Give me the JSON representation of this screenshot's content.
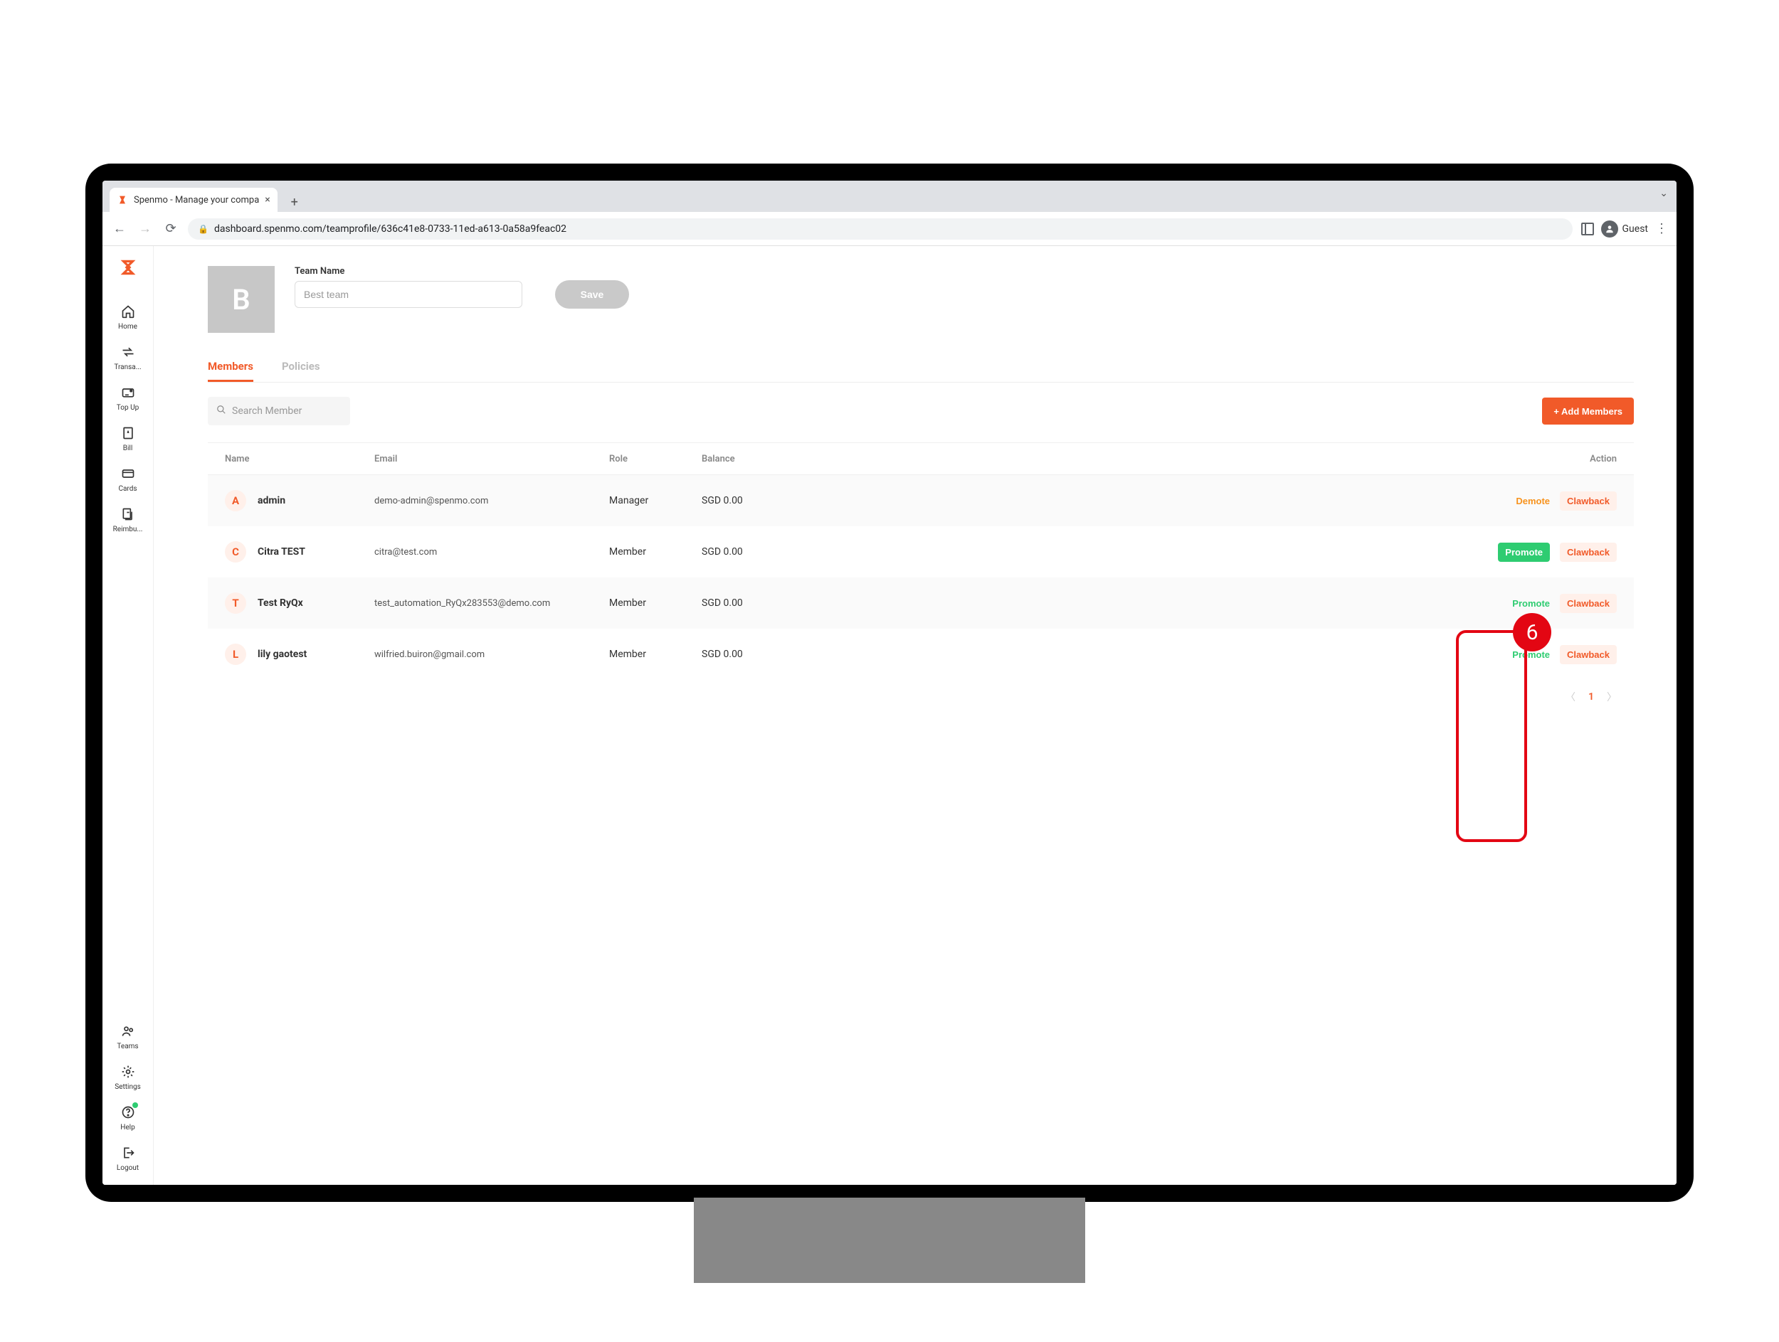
{
  "browser": {
    "tab_title": "Spenmo - Manage your compa",
    "url": "dashboard.spenmo.com/teamprofile/636c41e8-0733-11ed-a613-0a58a9feac02",
    "guest_label": "Guest"
  },
  "sidebar": {
    "top": [
      {
        "id": "home",
        "label": "Home"
      },
      {
        "id": "transactions",
        "label": "Transa..."
      },
      {
        "id": "topup",
        "label": "Top Up"
      },
      {
        "id": "bill",
        "label": "Bill"
      },
      {
        "id": "cards",
        "label": "Cards"
      },
      {
        "id": "reimbursements",
        "label": "Reimbu..."
      }
    ],
    "bottom": [
      {
        "id": "teams",
        "label": "Teams"
      },
      {
        "id": "settings",
        "label": "Settings"
      },
      {
        "id": "help",
        "label": "Help"
      },
      {
        "id": "logout",
        "label": "Logout"
      }
    ]
  },
  "team": {
    "avatar_letter": "B",
    "name_label": "Team Name",
    "name_value": "Best team",
    "save_label": "Save"
  },
  "tabs": {
    "members": "Members",
    "policies": "Policies"
  },
  "search": {
    "placeholder": "Search Member"
  },
  "add_members_label": "+ Add Members",
  "columns": {
    "name": "Name",
    "email": "Email",
    "role": "Role",
    "balance": "Balance",
    "action": "Action"
  },
  "actions": {
    "demote": "Demote",
    "promote": "Promote",
    "clawback": "Clawback"
  },
  "members": [
    {
      "initial": "A",
      "name": "admin",
      "email": "demo-admin@spenmo.com",
      "role": "Manager",
      "balance": "SGD 0.00",
      "primary_action": "demote",
      "primary_style": "orange-ghost"
    },
    {
      "initial": "C",
      "name": "Citra TEST",
      "email": "citra@test.com",
      "role": "Member",
      "balance": "SGD 0.00",
      "primary_action": "promote",
      "primary_style": "green"
    },
    {
      "initial": "T",
      "name": "Test RyQx",
      "email": "test_automation_RyQx283553@demo.com",
      "role": "Member",
      "balance": "SGD 0.00",
      "primary_action": "promote",
      "primary_style": "green-ghost"
    },
    {
      "initial": "L",
      "name": "lily gaotest",
      "email": "wilfried.buiron@gmail.com",
      "role": "Member",
      "balance": "SGD 0.00",
      "primary_action": "promote",
      "primary_style": "green-ghost"
    }
  ],
  "pagination": {
    "current": "1"
  },
  "annotation": {
    "step": "6"
  }
}
